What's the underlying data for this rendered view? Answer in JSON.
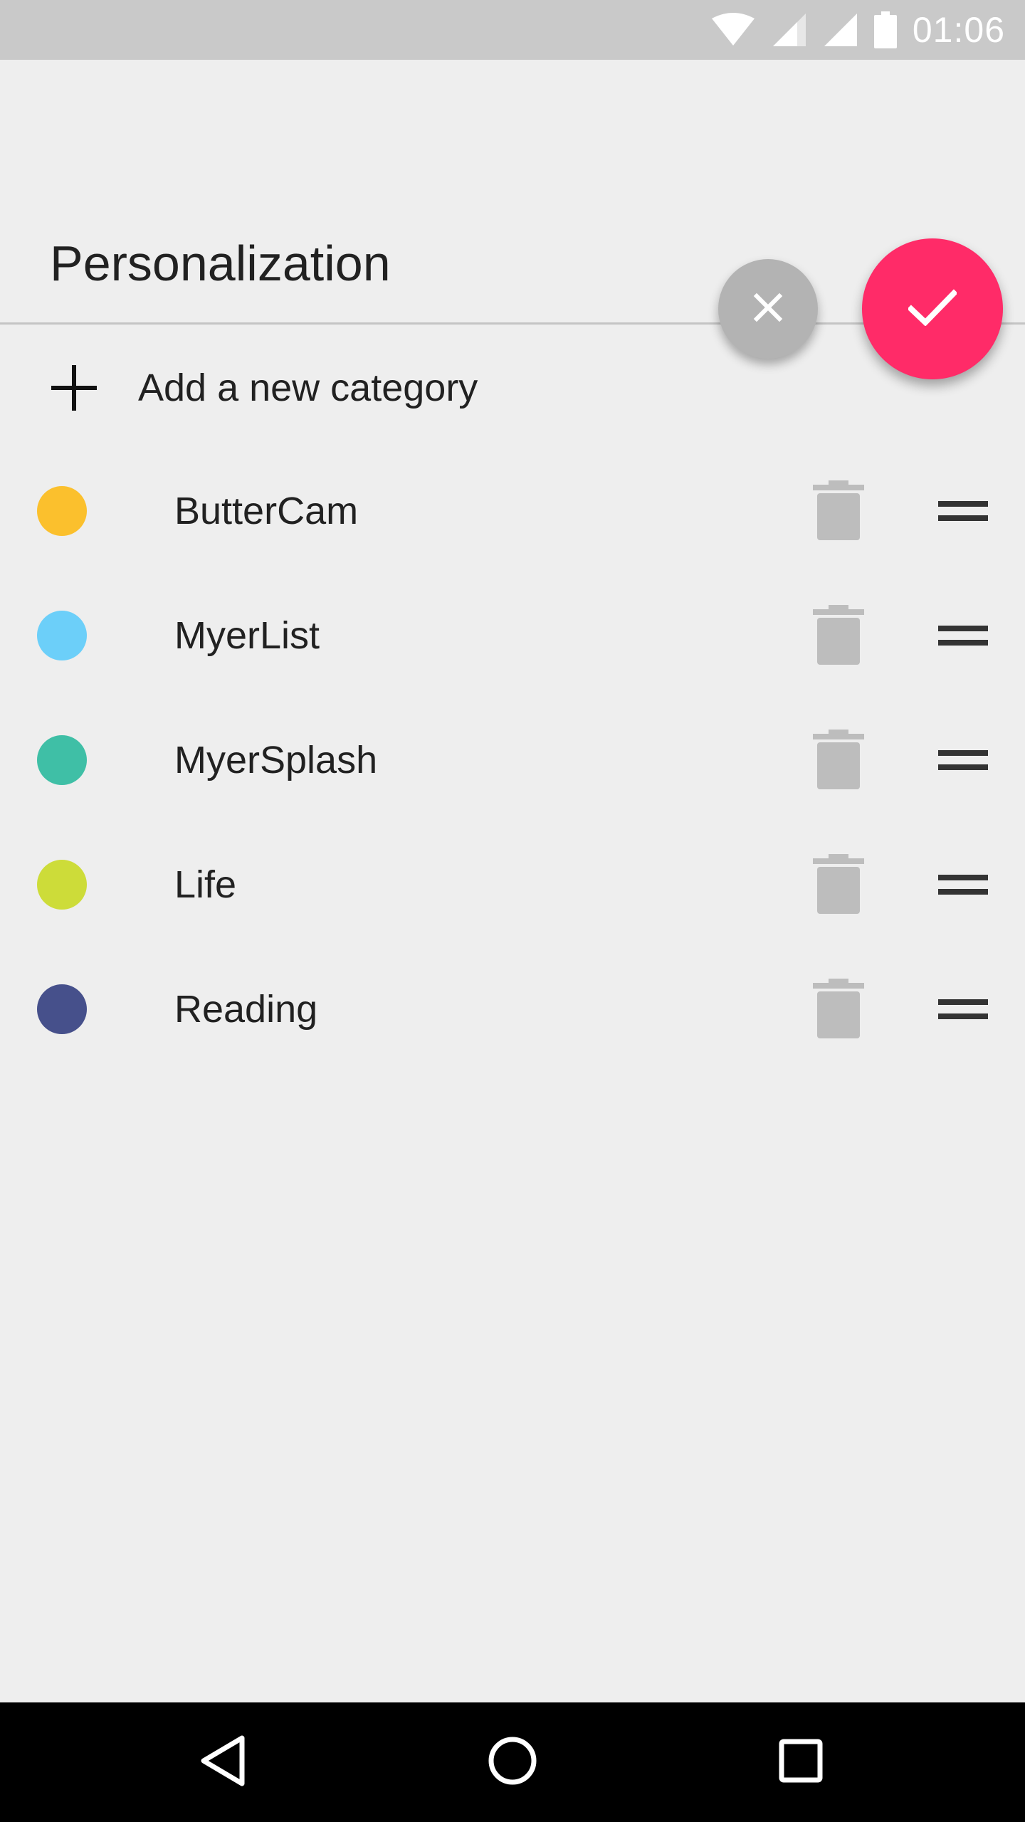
{
  "status_bar": {
    "time": "01:06",
    "icons": [
      "wifi-icon",
      "signal-icon",
      "signal-icon",
      "battery-icon"
    ]
  },
  "header": {
    "title": "Personalization"
  },
  "actions": {
    "cancel_icon": "close-icon",
    "confirm_icon": "check-icon",
    "cancel_color": "#b3b3b3",
    "confirm_color": "#ff2b68"
  },
  "add_category": {
    "icon": "plus-icon",
    "label": "Add a new category"
  },
  "categories": [
    {
      "name": "ButterCam",
      "color": "#fbc02d"
    },
    {
      "name": "MyerList",
      "color": "#6ccff9"
    },
    {
      "name": "MyerSplash",
      "color": "#3fbfa6"
    },
    {
      "name": "Life",
      "color": "#cddc39"
    },
    {
      "name": "Reading",
      "color": "#46508b"
    }
  ],
  "row_icons": {
    "delete": "trash-icon",
    "drag": "drag-handle-icon"
  },
  "nav_bar": {
    "buttons": [
      "back-icon",
      "home-icon",
      "recents-icon"
    ]
  }
}
